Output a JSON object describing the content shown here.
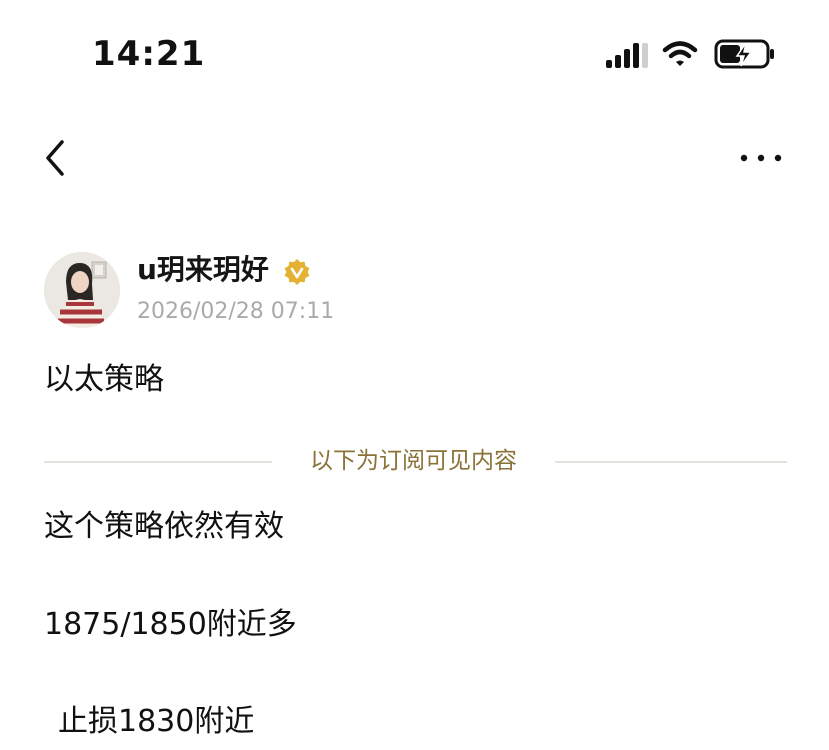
{
  "status_bar": {
    "time": "14:21"
  },
  "nav": {
    "back_icon": "chevron-left-icon",
    "more_icon": "ellipsis-icon"
  },
  "author": {
    "name": "u玥来玥好",
    "verified_icon": "verified-badge-icon",
    "verified_color": "#E3B233",
    "timestamp": "2026/02/28 07:11"
  },
  "post": {
    "title": "以太策略",
    "divider_text": "以下为订阅可见内容",
    "divider_text_color": "#8A7238",
    "paragraphs": [
      "这个策略依然有效",
      "1875/1850附近多",
      "止损1830附近"
    ]
  }
}
